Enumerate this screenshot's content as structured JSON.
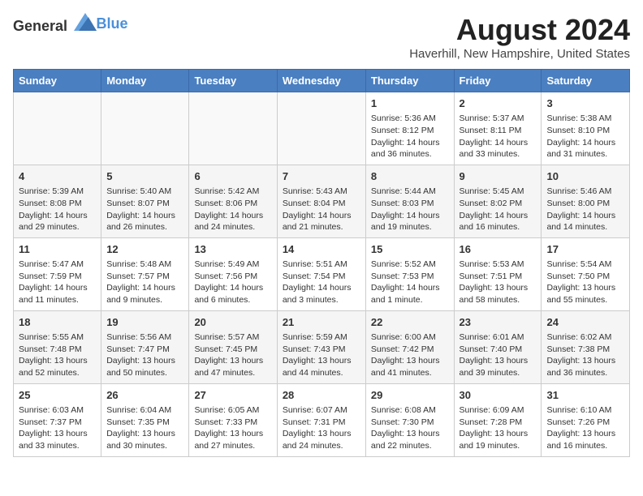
{
  "header": {
    "logo_general": "General",
    "logo_blue": "Blue",
    "month_year": "August 2024",
    "location": "Haverhill, New Hampshire, United States"
  },
  "days_of_week": [
    "Sunday",
    "Monday",
    "Tuesday",
    "Wednesday",
    "Thursday",
    "Friday",
    "Saturday"
  ],
  "weeks": [
    {
      "days": [
        {
          "num": "",
          "info": ""
        },
        {
          "num": "",
          "info": ""
        },
        {
          "num": "",
          "info": ""
        },
        {
          "num": "",
          "info": ""
        },
        {
          "num": "1",
          "info": "Sunrise: 5:36 AM\nSunset: 8:12 PM\nDaylight: 14 hours and 36 minutes."
        },
        {
          "num": "2",
          "info": "Sunrise: 5:37 AM\nSunset: 8:11 PM\nDaylight: 14 hours and 33 minutes."
        },
        {
          "num": "3",
          "info": "Sunrise: 5:38 AM\nSunset: 8:10 PM\nDaylight: 14 hours and 31 minutes."
        }
      ]
    },
    {
      "days": [
        {
          "num": "4",
          "info": "Sunrise: 5:39 AM\nSunset: 8:08 PM\nDaylight: 14 hours and 29 minutes."
        },
        {
          "num": "5",
          "info": "Sunrise: 5:40 AM\nSunset: 8:07 PM\nDaylight: 14 hours and 26 minutes."
        },
        {
          "num": "6",
          "info": "Sunrise: 5:42 AM\nSunset: 8:06 PM\nDaylight: 14 hours and 24 minutes."
        },
        {
          "num": "7",
          "info": "Sunrise: 5:43 AM\nSunset: 8:04 PM\nDaylight: 14 hours and 21 minutes."
        },
        {
          "num": "8",
          "info": "Sunrise: 5:44 AM\nSunset: 8:03 PM\nDaylight: 14 hours and 19 minutes."
        },
        {
          "num": "9",
          "info": "Sunrise: 5:45 AM\nSunset: 8:02 PM\nDaylight: 14 hours and 16 minutes."
        },
        {
          "num": "10",
          "info": "Sunrise: 5:46 AM\nSunset: 8:00 PM\nDaylight: 14 hours and 14 minutes."
        }
      ]
    },
    {
      "days": [
        {
          "num": "11",
          "info": "Sunrise: 5:47 AM\nSunset: 7:59 PM\nDaylight: 14 hours and 11 minutes."
        },
        {
          "num": "12",
          "info": "Sunrise: 5:48 AM\nSunset: 7:57 PM\nDaylight: 14 hours and 9 minutes."
        },
        {
          "num": "13",
          "info": "Sunrise: 5:49 AM\nSunset: 7:56 PM\nDaylight: 14 hours and 6 minutes."
        },
        {
          "num": "14",
          "info": "Sunrise: 5:51 AM\nSunset: 7:54 PM\nDaylight: 14 hours and 3 minutes."
        },
        {
          "num": "15",
          "info": "Sunrise: 5:52 AM\nSunset: 7:53 PM\nDaylight: 14 hours and 1 minute."
        },
        {
          "num": "16",
          "info": "Sunrise: 5:53 AM\nSunset: 7:51 PM\nDaylight: 13 hours and 58 minutes."
        },
        {
          "num": "17",
          "info": "Sunrise: 5:54 AM\nSunset: 7:50 PM\nDaylight: 13 hours and 55 minutes."
        }
      ]
    },
    {
      "days": [
        {
          "num": "18",
          "info": "Sunrise: 5:55 AM\nSunset: 7:48 PM\nDaylight: 13 hours and 52 minutes."
        },
        {
          "num": "19",
          "info": "Sunrise: 5:56 AM\nSunset: 7:47 PM\nDaylight: 13 hours and 50 minutes."
        },
        {
          "num": "20",
          "info": "Sunrise: 5:57 AM\nSunset: 7:45 PM\nDaylight: 13 hours and 47 minutes."
        },
        {
          "num": "21",
          "info": "Sunrise: 5:59 AM\nSunset: 7:43 PM\nDaylight: 13 hours and 44 minutes."
        },
        {
          "num": "22",
          "info": "Sunrise: 6:00 AM\nSunset: 7:42 PM\nDaylight: 13 hours and 41 minutes."
        },
        {
          "num": "23",
          "info": "Sunrise: 6:01 AM\nSunset: 7:40 PM\nDaylight: 13 hours and 39 minutes."
        },
        {
          "num": "24",
          "info": "Sunrise: 6:02 AM\nSunset: 7:38 PM\nDaylight: 13 hours and 36 minutes."
        }
      ]
    },
    {
      "days": [
        {
          "num": "25",
          "info": "Sunrise: 6:03 AM\nSunset: 7:37 PM\nDaylight: 13 hours and 33 minutes."
        },
        {
          "num": "26",
          "info": "Sunrise: 6:04 AM\nSunset: 7:35 PM\nDaylight: 13 hours and 30 minutes."
        },
        {
          "num": "27",
          "info": "Sunrise: 6:05 AM\nSunset: 7:33 PM\nDaylight: 13 hours and 27 minutes."
        },
        {
          "num": "28",
          "info": "Sunrise: 6:07 AM\nSunset: 7:31 PM\nDaylight: 13 hours and 24 minutes."
        },
        {
          "num": "29",
          "info": "Sunrise: 6:08 AM\nSunset: 7:30 PM\nDaylight: 13 hours and 22 minutes."
        },
        {
          "num": "30",
          "info": "Sunrise: 6:09 AM\nSunset: 7:28 PM\nDaylight: 13 hours and 19 minutes."
        },
        {
          "num": "31",
          "info": "Sunrise: 6:10 AM\nSunset: 7:26 PM\nDaylight: 13 hours and 16 minutes."
        }
      ]
    }
  ]
}
